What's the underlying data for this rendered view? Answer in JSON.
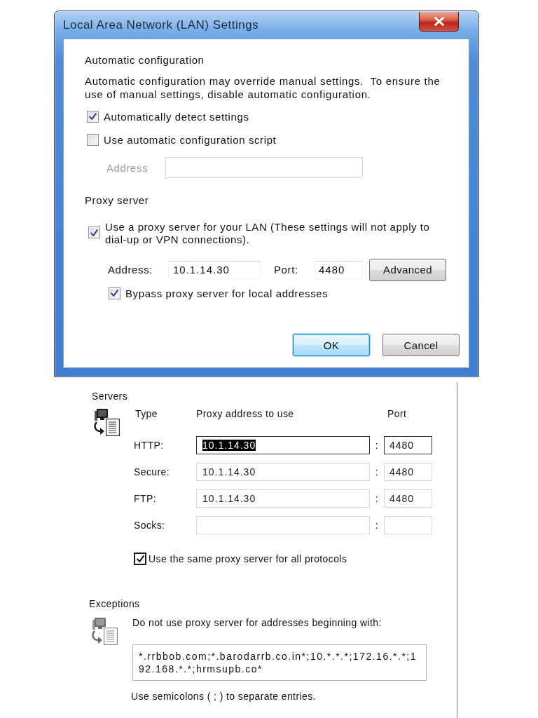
{
  "dialog": {
    "title": "Local Area Network (LAN) Settings",
    "automatic_configuration": {
      "heading": "Automatic configuration",
      "description": "Automatic configuration may override manual settings.  To ensure the use of manual settings, disable automatic configuration.",
      "options": [
        {
          "label": "Automatically detect settings",
          "checked": true
        },
        {
          "label": "Use automatic configuration script",
          "checked": false
        }
      ],
      "script_address": {
        "label": "Address",
        "disabled": true
      }
    },
    "proxy_server": {
      "heading": "Proxy server",
      "use_proxy": {
        "label": "Use a proxy server for your LAN (These settings will not apply to dial-up or VPN connections).",
        "checked": true
      },
      "address": {
        "label": "Address:",
        "value": "10.1.14.30"
      },
      "port": {
        "label": "Port:",
        "value": "4480"
      },
      "advanced_button": "Advanced",
      "bypass_local": {
        "label": "Bypass proxy server for local addresses",
        "checked": true
      }
    },
    "buttons": [
      {
        "label": "OK",
        "focused": true
      },
      {
        "label": "Cancel",
        "focused": false
      }
    ]
  },
  "proxy_settings": {
    "servers": {
      "heading": "Servers",
      "columns": [
        "Type",
        "Proxy address to use",
        "Port"
      ],
      "rows": [
        {
          "type": "HTTP:",
          "address": "10.1.14.30",
          "separator": ":",
          "port": "4480",
          "disabled": false,
          "address_selected": true
        },
        {
          "type": "Secure:",
          "address": "10.1.14.30",
          "separator": ":",
          "port": "4480",
          "disabled": true,
          "address_selected": false
        },
        {
          "type": "FTP:",
          "address": "10.1.14.30",
          "separator": ":",
          "port": "4480",
          "disabled": true,
          "address_selected": false
        },
        {
          "type": "Socks:",
          "separator": ":",
          "disabled": true
        }
      ],
      "same_for_all": {
        "label": "Use the same proxy server for all protocols",
        "checked": true
      }
    },
    "exceptions": {
      "heading": "Exceptions",
      "instruction": "Do not use proxy server for addresses beginning with:",
      "value": "*.rrbbob.com;*.barodarrb.co.in*;10.*.*.*;172.16.*.*;192.168.*.*;hrmsupb.co*",
      "note": "Use semicolons ( ; ) to separate entries."
    }
  }
}
